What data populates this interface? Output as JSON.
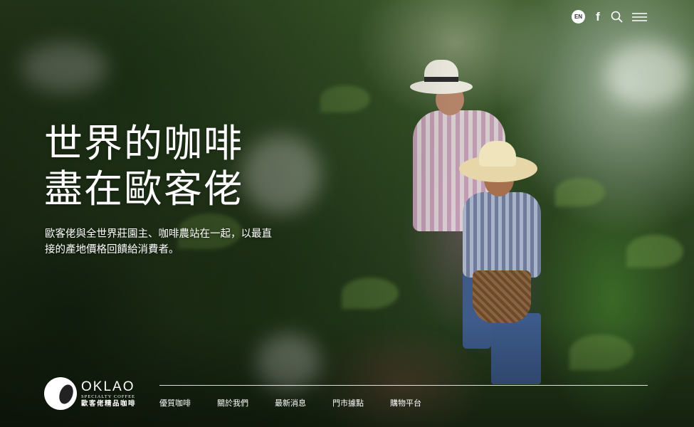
{
  "header": {
    "language_label": "EN",
    "icons": [
      "language-icon",
      "facebook-icon",
      "search-icon",
      "menu-icon"
    ],
    "facebook_glyph": "f"
  },
  "hero": {
    "headline_line1": "世界的咖啡",
    "headline_line2": "盡在歐客佬",
    "subtitle": "歐客佬與全世界莊園主、咖啡農站在一起，以最直接的產地價格回饋給消費者。"
  },
  "logo": {
    "brand": "OKLAO",
    "tagline": "SPECIALTY COFFEE",
    "chinese_name": "歐客佬精品咖啡"
  },
  "nav": {
    "items": [
      "優質咖啡",
      "關於我們",
      "最新消息",
      "門市據點",
      "購物平台"
    ]
  },
  "colors": {
    "text": "#ffffff",
    "foliage_dark": "#1f3317",
    "foliage_mid": "#3b5a2a"
  }
}
